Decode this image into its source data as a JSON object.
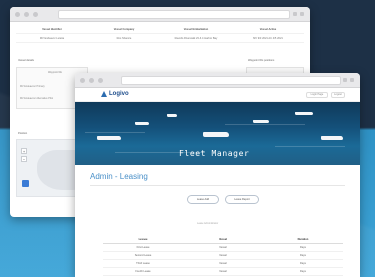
{
  "back_window": {
    "table": {
      "columns": [
        "Vessel Identifier",
        "Vessel Company",
        "Vessel Embarkation",
        "Vessel Active"
      ],
      "rows": [
        [
          "MV Endeavor Lutetia",
          "Ros Shanice",
          "Ravello Riverwalk 23 & 4 Harbor Bay",
          "MV 9/3 2021 AC 4/5 2021"
        ]
      ]
    },
    "section_left": "Vessel details",
    "section_right": "Waypoint IDs positions",
    "box_lines": [
      "Waypoint NE",
      "MV Endeavour Primary",
      "MV Endeavour Alternative Pilot"
    ],
    "map_label": "Position",
    "map_ctrl_plus": "+",
    "map_ctrl_minus": "−"
  },
  "front_window": {
    "brand": "Logivo",
    "header_buttons": [
      "Login Page",
      "Logout"
    ],
    "hero_title": "Fleet Manager",
    "page_title": "Admin - Leasing",
    "pills": [
      "Lease Add",
      "Lease Report"
    ],
    "small_note": "Lease Administrator",
    "table": {
      "columns": [
        "Lessee",
        "Vessel",
        "Duration"
      ],
      "rows": [
        [
          "First Lease",
          "Vessel",
          "Days"
        ],
        [
          "Second Lease",
          "Vessel",
          "Days"
        ],
        [
          "Third Lease",
          "Vessel",
          "Days"
        ],
        [
          "Fourth Lease",
          "Vessel",
          "Days"
        ]
      ]
    }
  },
  "colors": {
    "background_dark": "#1d3046",
    "background_blue": "#3ea5d8",
    "brand_blue": "#1f4e8c",
    "title_blue": "#4a90c8"
  }
}
